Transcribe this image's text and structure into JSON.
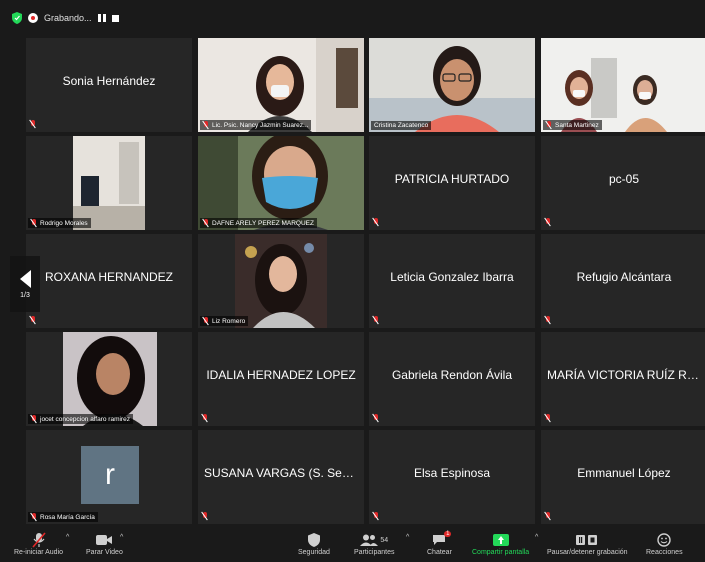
{
  "recording": {
    "label": "Grabando..."
  },
  "pager": {
    "label": "1/3"
  },
  "tiles": [
    {
      "name": "Sonia Hernández"
    },
    {
      "label": "Lic. Psic. Nancy Jazmin Suarez..."
    },
    {
      "label": "Cristina Zacatenco"
    },
    {
      "label": "Santa Martinez"
    },
    {
      "label": "Rodrigo Morales"
    },
    {
      "label": "DAFNE ARELY PEREZ MARQUEZ"
    },
    {
      "name": "PATRICIA HURTADO"
    },
    {
      "name": "pc-05"
    },
    {
      "name": "ROXANA HERNANDEZ"
    },
    {
      "label": "Liz Romero"
    },
    {
      "name": "Leticia Gonzalez Ibarra"
    },
    {
      "name": "Refugio Alcántara"
    },
    {
      "label": "jocet concepcion alfaro ramirez"
    },
    {
      "name": "IDALIA HERNADEZ LOPEZ"
    },
    {
      "name": "Gabriela Rendon Ávila"
    },
    {
      "name": "MARÍA VICTORIA RUÍZ RO..."
    },
    {
      "avatar": "r",
      "label": "Rosa María García"
    },
    {
      "name": "SUSANA VARGAS (S. Segu..."
    },
    {
      "name": "Elsa Espinosa"
    },
    {
      "name": "Emmanuel López"
    }
  ],
  "toolbar": {
    "audio": "Re-iniciar Audio",
    "video": "Parar Video",
    "security": "Seguridad",
    "participants": "Participantes",
    "participants_count": "54",
    "chat": "Chatear",
    "chat_badge": "1",
    "share": "Compartir pantalla",
    "record": "Pausar/detener grabación",
    "reactions": "Reacciones"
  },
  "colors": {
    "background": "#1a1a1a",
    "tile": "#262626",
    "active_speaker": "#c3df5a",
    "share_green": "#23d959",
    "mic_muted": "#e02828"
  }
}
